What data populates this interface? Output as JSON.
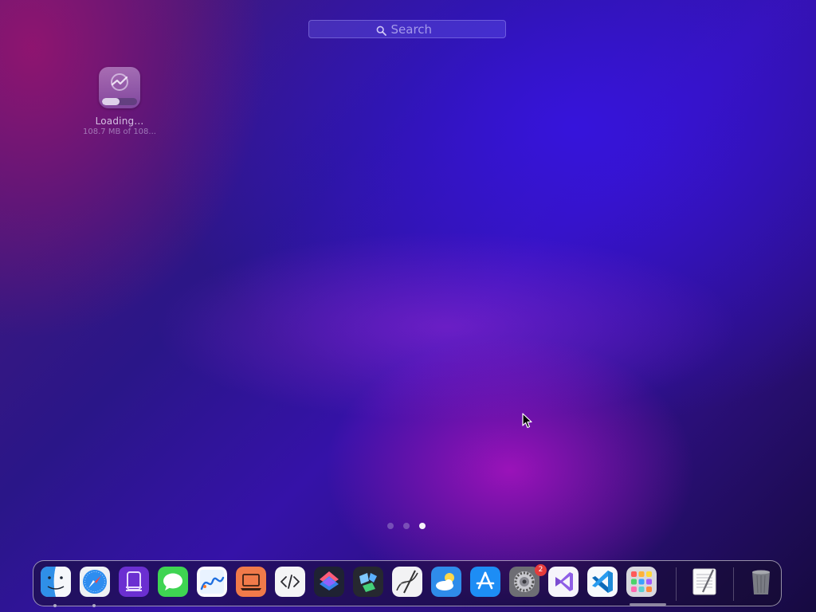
{
  "search": {
    "placeholder": "Search",
    "icon": "magnifying-glass-icon"
  },
  "launchpad_app": {
    "name": "Loading...",
    "status": "108.7 MB of 108...",
    "icon": "app-download-icon",
    "progress_fraction": 0.5
  },
  "pages": {
    "count": 3,
    "current": 3
  },
  "dock": {
    "items": [
      {
        "name": "Finder",
        "icon": "finder-icon",
        "running": true
      },
      {
        "name": "Safari",
        "icon": "safari-icon",
        "running": true
      },
      {
        "name": "Simulator",
        "icon": "simulator-icon",
        "running": false
      },
      {
        "name": "Messages",
        "icon": "messages-icon",
        "running": false
      },
      {
        "name": "Freeform",
        "icon": "freeform-icon",
        "running": false
      },
      {
        "name": "Remote Desktop",
        "icon": "laptop-icon",
        "running": false
      },
      {
        "name": "Script Editor",
        "icon": "code-icon",
        "running": false
      },
      {
        "name": "Shortcuts",
        "icon": "shortcuts-icon",
        "running": false
      },
      {
        "name": "Apps",
        "icon": "apps-icon",
        "running": false
      },
      {
        "name": "Script Editor",
        "icon": "script-icon",
        "running": false
      },
      {
        "name": "Weather",
        "icon": "weather-icon",
        "running": false
      },
      {
        "name": "App Store",
        "icon": "app-store-icon",
        "running": false
      },
      {
        "name": "System Settings",
        "icon": "settings-icon",
        "running": false,
        "badge": "2"
      },
      {
        "name": "Visual Studio",
        "icon": "visual-studio-icon",
        "running": false
      },
      {
        "name": "Visual Studio Code",
        "icon": "vscode-icon",
        "running": false
      },
      {
        "name": "Launchpad",
        "icon": "launchpad-icon",
        "running": false
      },
      {
        "name": "TextEdit Document",
        "icon": "document-icon",
        "running": false
      },
      {
        "name": "Trash",
        "icon": "trash-icon",
        "running": false
      }
    ]
  },
  "colors": {
    "badge": "#e63b3b",
    "accent": "#2a1688"
  }
}
